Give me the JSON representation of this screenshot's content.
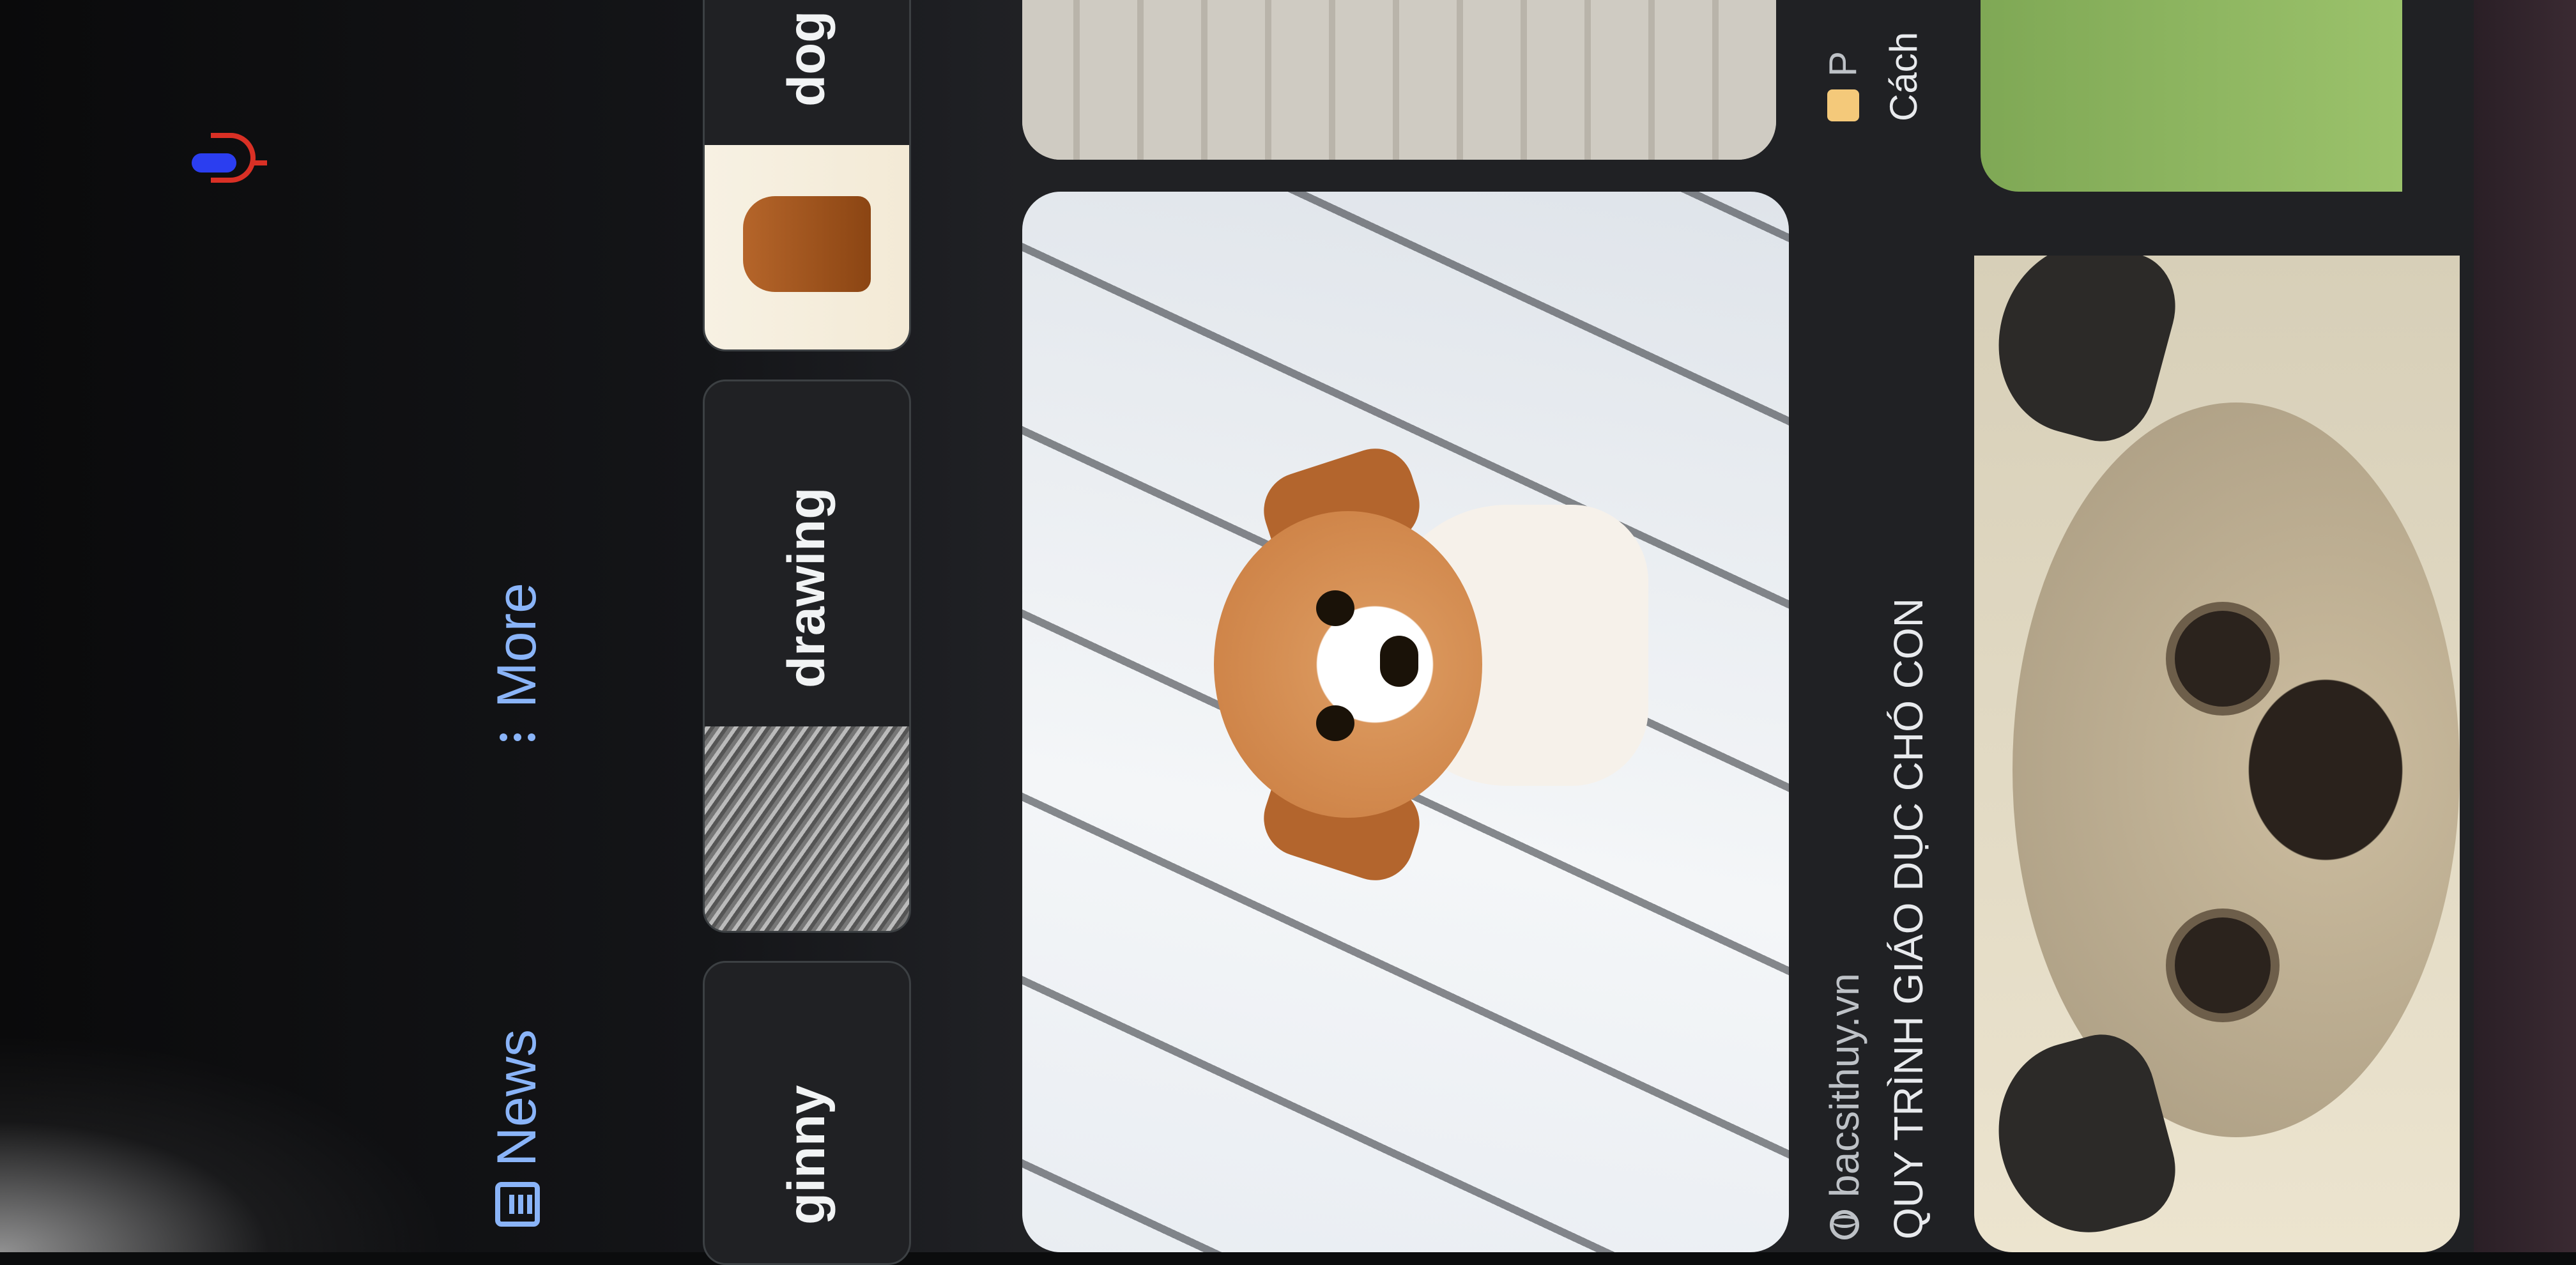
{
  "tabs": {
    "news_label": "News",
    "more_label": "More"
  },
  "chips": [
    {
      "label": "ginny"
    },
    {
      "label": "drawing"
    },
    {
      "label": "dog"
    }
  ],
  "results": {
    "main": {
      "source": "bacsithuy.vn",
      "title": "QUY TRÌNH GIÁO DỤC CHÓ CON"
    },
    "side": {
      "source": "P",
      "title": "Cách"
    }
  },
  "colors": {
    "background": "#202124",
    "link": "#8ab4f8",
    "text": "#e8eaed",
    "mic_blue": "#2b3ef0",
    "mic_red": "#d93025"
  }
}
